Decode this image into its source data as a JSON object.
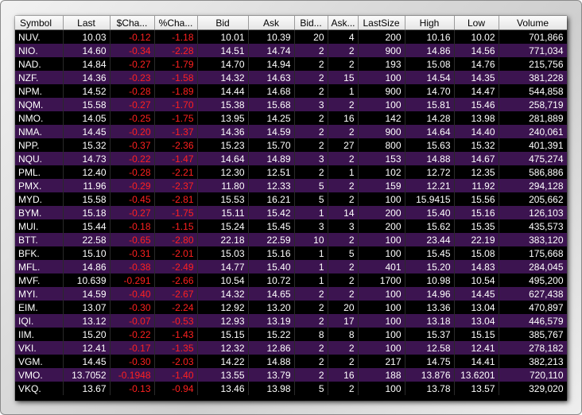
{
  "columns": [
    "Symbol",
    "Last",
    "$Cha...",
    "%Cha...",
    "Bid",
    "Ask",
    "Bid...",
    "Ask...",
    "LastSize",
    "High",
    "Low",
    "Volume"
  ],
  "rows": [
    [
      "NUV.",
      "10.03",
      "-0.12",
      "-1.18",
      "10.01",
      "10.39",
      "20",
      "4",
      "200",
      "10.16",
      "10.02",
      "701,866"
    ],
    [
      "NIO.",
      "14.60",
      "-0.34",
      "-2.28",
      "14.51",
      "14.74",
      "2",
      "2",
      "900",
      "14.86",
      "14.56",
      "771,034"
    ],
    [
      "NAD.",
      "14.84",
      "-0.27",
      "-1.79",
      "14.70",
      "14.94",
      "2",
      "2",
      "193",
      "15.08",
      "14.76",
      "215,756"
    ],
    [
      "NZF.",
      "14.36",
      "-0.23",
      "-1.58",
      "14.32",
      "14.63",
      "2",
      "15",
      "100",
      "14.54",
      "14.35",
      "381,228"
    ],
    [
      "NPM.",
      "14.52",
      "-0.28",
      "-1.89",
      "14.44",
      "14.68",
      "2",
      "1",
      "900",
      "14.70",
      "14.47",
      "544,858"
    ],
    [
      "NQM.",
      "15.58",
      "-0.27",
      "-1.70",
      "15.38",
      "15.68",
      "3",
      "2",
      "100",
      "15.81",
      "15.46",
      "258,719"
    ],
    [
      "NMO.",
      "14.05",
      "-0.25",
      "-1.75",
      "13.95",
      "14.25",
      "2",
      "16",
      "142",
      "14.28",
      "13.98",
      "281,889"
    ],
    [
      "NMA.",
      "14.45",
      "-0.20",
      "-1.37",
      "14.36",
      "14.59",
      "2",
      "2",
      "900",
      "14.64",
      "14.40",
      "240,061"
    ],
    [
      "NPP.",
      "15.32",
      "-0.37",
      "-2.36",
      "15.23",
      "15.70",
      "2",
      "27",
      "800",
      "15.63",
      "15.32",
      "401,391"
    ],
    [
      "NQU.",
      "14.73",
      "-0.22",
      "-1.47",
      "14.64",
      "14.89",
      "3",
      "2",
      "153",
      "14.88",
      "14.67",
      "475,274"
    ],
    [
      "PML.",
      "12.40",
      "-0.28",
      "-2.21",
      "12.30",
      "12.51",
      "2",
      "1",
      "102",
      "12.72",
      "12.35",
      "586,886"
    ],
    [
      "PMX.",
      "11.96",
      "-0.29",
      "-2.37",
      "11.80",
      "12.33",
      "5",
      "2",
      "159",
      "12.21",
      "11.92",
      "294,128"
    ],
    [
      "MYD.",
      "15.58",
      "-0.45",
      "-2.81",
      "15.53",
      "16.21",
      "5",
      "2",
      "100",
      "15.9415",
      "15.56",
      "205,662"
    ],
    [
      "BYM.",
      "15.18",
      "-0.27",
      "-1.75",
      "15.11",
      "15.42",
      "1",
      "14",
      "200",
      "15.40",
      "15.16",
      "126,103"
    ],
    [
      "MUI.",
      "15.44",
      "-0.18",
      "-1.15",
      "15.24",
      "15.45",
      "3",
      "3",
      "200",
      "15.62",
      "15.35",
      "435,573"
    ],
    [
      "BTT.",
      "22.58",
      "-0.65",
      "-2.80",
      "22.18",
      "22.59",
      "10",
      "2",
      "100",
      "23.44",
      "22.19",
      "383,120"
    ],
    [
      "BFK.",
      "15.10",
      "-0.31",
      "-2.01",
      "15.03",
      "15.16",
      "1",
      "5",
      "100",
      "15.45",
      "15.08",
      "175,668"
    ],
    [
      "MFL.",
      "14.86",
      "-0.38",
      "-2.49",
      "14.77",
      "15.40",
      "1",
      "2",
      "401",
      "15.20",
      "14.83",
      "284,045"
    ],
    [
      "MVF.",
      "10.639",
      "-0.291",
      "-2.66",
      "10.54",
      "10.72",
      "1",
      "2",
      "1700",
      "10.98",
      "10.54",
      "495,200"
    ],
    [
      "MYI.",
      "14.59",
      "-0.40",
      "-2.67",
      "14.32",
      "14.65",
      "2",
      "2",
      "100",
      "14.96",
      "14.45",
      "627,438"
    ],
    [
      "EIM.",
      "13.07",
      "-0.30",
      "-2.24",
      "12.92",
      "13.20",
      "2",
      "20",
      "100",
      "13.36",
      "13.04",
      "470,897"
    ],
    [
      "IQI.",
      "13.12",
      "-0.07",
      "-0.53",
      "12.93",
      "13.19",
      "2",
      "17",
      "100",
      "13.18",
      "13.04",
      "446,579"
    ],
    [
      "IIM.",
      "15.20",
      "-0.22",
      "-1.43",
      "15.15",
      "15.22",
      "8",
      "8",
      "100",
      "15.37",
      "15.15",
      "385,767"
    ],
    [
      "VKI.",
      "12.41",
      "-0.17",
      "-1.35",
      "12.32",
      "12.86",
      "2",
      "2",
      "100",
      "12.58",
      "12.41",
      "278,182"
    ],
    [
      "VGM.",
      "14.45",
      "-0.30",
      "-2.03",
      "14.22",
      "14.88",
      "2",
      "2",
      "217",
      "14.75",
      "14.41",
      "382,213"
    ],
    [
      "VMO.",
      "13.7052",
      "-0.1948",
      "-1.40",
      "13.55",
      "13.79",
      "2",
      "16",
      "188",
      "13.876",
      "13.6201",
      "720,110"
    ],
    [
      "VKQ.",
      "13.67",
      "-0.13",
      "-0.94",
      "13.46",
      "13.98",
      "5",
      "2",
      "100",
      "13.78",
      "13.57",
      "329,020"
    ]
  ],
  "colors": {
    "row_odd": "#000000",
    "row_even": "#3c1450",
    "text": "#ffffff",
    "negative": "#ff2020"
  }
}
